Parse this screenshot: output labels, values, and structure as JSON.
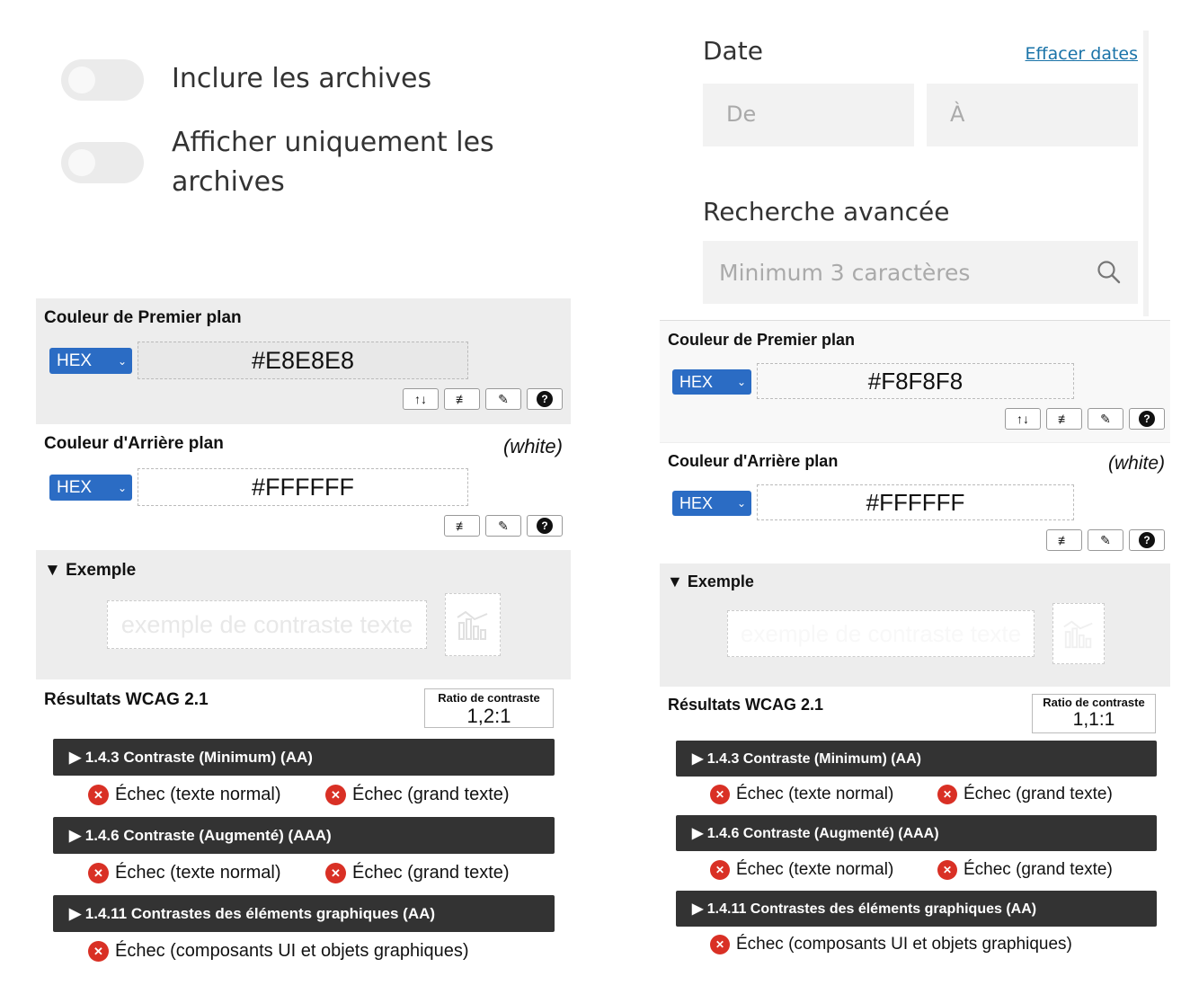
{
  "toggles": [
    {
      "label": "Inclure les archives",
      "on": false
    },
    {
      "label": "Afficher uniquement les archives",
      "on": false
    }
  ],
  "filters": {
    "date_title": "Date",
    "clear_dates": "Effacer dates",
    "from_placeholder": "De",
    "to_placeholder": "À",
    "advanced_title": "Recherche avancée",
    "search_placeholder": "Minimum 3 caractères",
    "search_icon": "search-icon"
  },
  "panels": [
    {
      "foreground_title": "Couleur de Premier plan",
      "foreground_format": "HEX",
      "foreground_value": "#E8E8E8",
      "background_title": "Couleur d'Arrière plan",
      "background_note": "(white)",
      "background_format": "HEX",
      "background_value": "#FFFFFF",
      "example_title": "▼ Exemple",
      "example_text": "exemple de contraste texte",
      "results_title": "Résultats WCAG 2.1",
      "ratio_label": "Ratio de contraste",
      "ratio_value": "1,2:1",
      "criteria": [
        {
          "title": "▶  1.4.3 Contraste (Minimum) (AA)",
          "results": [
            "Échec (texte normal)",
            "Échec (grand texte)"
          ]
        },
        {
          "title": "▶  1.4.6 Contraste (Augmenté) (AAA)",
          "results": [
            "Échec (texte normal)",
            "Échec (grand texte)"
          ]
        },
        {
          "title": "▶  1.4.11 Contrastes des éléments graphiques (AA)",
          "results": [
            "Échec (composants UI et objets graphiques)"
          ]
        }
      ]
    },
    {
      "foreground_title": "Couleur de Premier plan",
      "foreground_format": "HEX",
      "foreground_value": "#F8F8F8",
      "background_title": "Couleur d'Arrière plan",
      "background_note": "(white)",
      "background_format": "HEX",
      "background_value": "#FFFFFF",
      "example_title": "▼ Exemple",
      "example_text": "exemple de contraste texte",
      "results_title": "Résultats WCAG 2.1",
      "ratio_label": "Ratio de contraste",
      "ratio_value": "1,1:1",
      "criteria": [
        {
          "title": "▶  1.4.3 Contraste (Minimum) (AA)",
          "results": [
            "Échec (texte normal)",
            "Échec (grand texte)"
          ]
        },
        {
          "title": "▶  1.4.6 Contraste (Augmenté) (AAA)",
          "results": [
            "Échec (texte normal)",
            "Échec (grand texte)"
          ]
        },
        {
          "title": "▶  1.4.11 Contrastes des éléments graphiques (AA)",
          "results": [
            "Échec (composants UI et objets graphiques)"
          ]
        }
      ]
    }
  ],
  "icons": {
    "swap": "↑↓",
    "sliders": "≢",
    "eyedropper": "✎",
    "help": "?",
    "fail": "✕"
  },
  "colors": {
    "select_blue": "#2b6cc4",
    "criteria_bar": "#333333",
    "fail_red": "#d93025",
    "link_blue": "#1a73a8"
  }
}
